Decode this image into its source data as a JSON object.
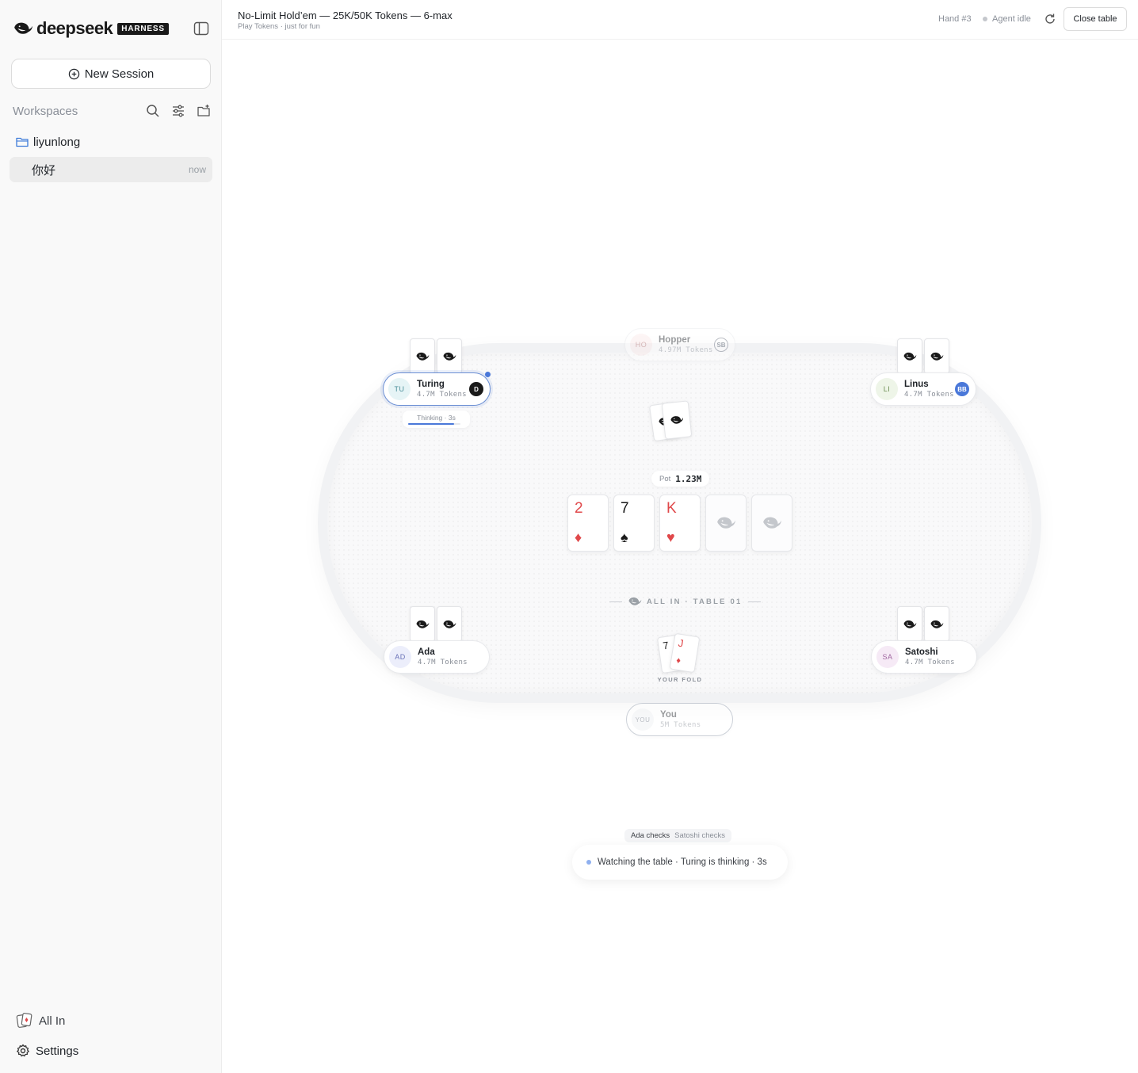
{
  "sidebar": {
    "brand": "deepseek",
    "brand_tag": "HARNESS",
    "new_session_label": "New Session",
    "workspaces_label": "Workspaces",
    "folder": "liyunlong",
    "session": {
      "name": "你好",
      "time": "now"
    },
    "allin_label": "All In",
    "settings_label": "Settings"
  },
  "header": {
    "title": "No-Limit Hold’em — 25K/50K Tokens — 6-max",
    "subtitle": "Play Tokens · just for fun",
    "hand": "Hand #3",
    "agent_status": "Agent idle",
    "close_label": "Close table"
  },
  "table": {
    "name": "ALL IN · TABLE 01",
    "pot_label": "Pot",
    "pot_value": "1.23M",
    "board": [
      {
        "rank": "2",
        "suit": "♦",
        "color": "#e0484a"
      },
      {
        "rank": "7",
        "suit": "♠",
        "color": "#1a1a1a"
      },
      {
        "rank": "K",
        "suit": "♥",
        "color": "#e0484a"
      }
    ],
    "thinking": {
      "label": "Thinking · 3s",
      "progress": 0.88
    },
    "fold": {
      "label": "YOUR FOLD",
      "cards": [
        {
          "rank": "7",
          "suit": ""
        },
        {
          "rank": "J",
          "suit": "♦"
        }
      ]
    }
  },
  "players": {
    "hopper": {
      "initials": "HO",
      "name": "Hopper",
      "chips": "4.97M Tokens",
      "badge": "SB"
    },
    "turing": {
      "initials": "TU",
      "name": "Turing",
      "chips": "4.7M Tokens",
      "badge": "D"
    },
    "linus": {
      "initials": "LI",
      "name": "Linus",
      "chips": "4.7M Tokens",
      "badge": "BB"
    },
    "ada": {
      "initials": "AD",
      "name": "Ada",
      "chips": "4.7M Tokens"
    },
    "satoshi": {
      "initials": "SA",
      "name": "Satoshi",
      "chips": "4.7M Tokens"
    },
    "you": {
      "initials": "YOU",
      "name": "You",
      "chips": "5M Tokens"
    }
  },
  "log": {
    "first": "Ada checks",
    "second": "Satoshi checks"
  },
  "status": "Watching the table · Turing is thinking · 3s",
  "colors": {
    "accent": "#4a78d9",
    "red_suit": "#e0484a",
    "black_suit": "#1a1a1a"
  }
}
